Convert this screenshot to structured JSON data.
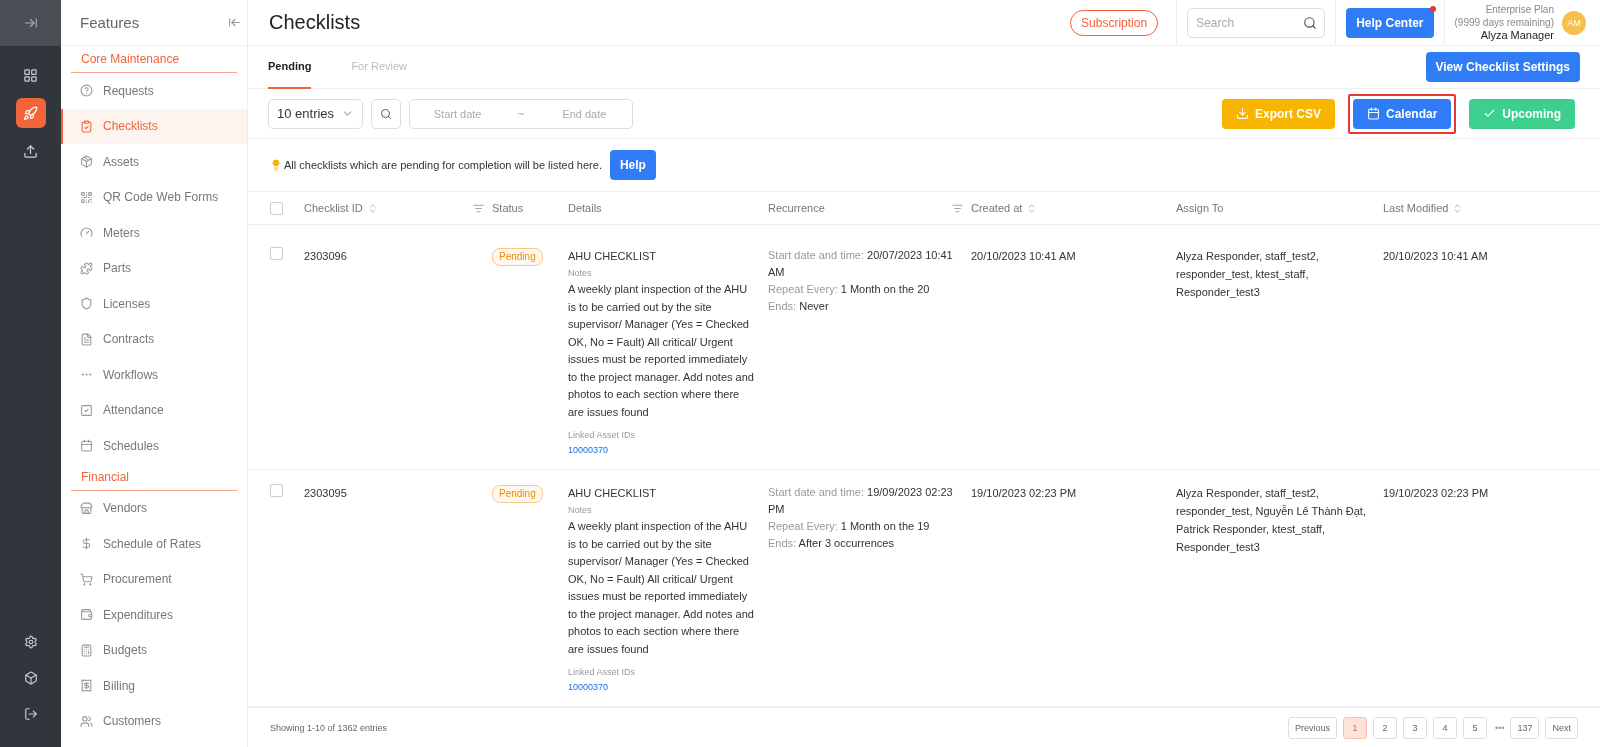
{
  "rail": {
    "items": [
      {
        "selected": false
      },
      {
        "selected": true
      },
      {
        "selected": false
      }
    ],
    "bottom_items": [
      {
        "selected": false
      },
      {
        "selected": false
      },
      {
        "selected": false
      }
    ]
  },
  "sidebar": {
    "title": "Features",
    "sections": [
      {
        "title": "Core Maintenance",
        "items": [
          {
            "label": "Requests",
            "selected": false
          },
          {
            "label": "Checklists",
            "selected": true
          },
          {
            "label": "Assets",
            "selected": false
          },
          {
            "label": "QR Code Web Forms",
            "selected": false
          },
          {
            "label": "Meters",
            "selected": false
          },
          {
            "label": "Parts",
            "selected": false
          },
          {
            "label": "Licenses",
            "selected": false
          },
          {
            "label": "Contracts",
            "selected": false
          },
          {
            "label": "Workflows",
            "selected": false
          },
          {
            "label": "Attendance",
            "selected": false
          },
          {
            "label": "Schedules",
            "selected": false
          }
        ]
      },
      {
        "title": "Financial",
        "items": [
          {
            "label": "Vendors",
            "selected": false
          },
          {
            "label": "Schedule of Rates",
            "selected": false
          },
          {
            "label": "Procurement",
            "selected": false
          },
          {
            "label": "Expenditures",
            "selected": false
          },
          {
            "label": "Budgets",
            "selected": false
          },
          {
            "label": "Billing",
            "selected": false
          },
          {
            "label": "Customers",
            "selected": false
          }
        ]
      }
    ]
  },
  "header": {
    "title": "Checklists",
    "subscription": "Subscription",
    "search": {
      "placeholder": "Search"
    },
    "help_center": {
      "label": "Help Center",
      "has_notification": true
    },
    "plan": "Enterprise Plan",
    "plan_remaining": "(9999 days remaining)",
    "user": "Alyza Manager",
    "avatar": "AM"
  },
  "tabs": [
    {
      "label": "Pending",
      "selected": true
    },
    {
      "label": "For Review",
      "selected": false
    }
  ],
  "settings_button": "View Checklist Settings",
  "toolbar": {
    "entries": "10 entries",
    "start_placeholder": "Start date",
    "separator": "~",
    "end_placeholder": "End date",
    "buttons": [
      {
        "kind": "export",
        "label": "Export CSV",
        "highlighted": false
      },
      {
        "kind": "calendar",
        "label": "Calendar",
        "highlighted": true
      },
      {
        "kind": "upcoming",
        "label": "Upcoming",
        "highlighted": false
      }
    ]
  },
  "info": {
    "text": "All checklists which are pending for completion will be listed here.",
    "button": "Help"
  },
  "table": {
    "select_all_checked": false,
    "columns": [
      {
        "label": "Checklist ID",
        "sortable": true,
        "filterable": true
      },
      {
        "label": "Status",
        "sortable": false,
        "filterable": false
      },
      {
        "label": "Details",
        "sortable": false,
        "filterable": false
      },
      {
        "label": "Recurrence",
        "sortable": false,
        "filterable": true
      },
      {
        "label": "Created at",
        "sortable": true,
        "filterable": false
      },
      {
        "label": "Assign To",
        "sortable": false,
        "filterable": false
      },
      {
        "label": "Last Modified",
        "sortable": true,
        "filterable": false
      }
    ],
    "rows": [
      {
        "checked": false,
        "id": "2303096",
        "status": "Pending",
        "title": "AHU CHECKLIST",
        "notes_label": "Notes",
        "notes": "A weekly plant inspection of the AHU is to be carried out by the site supervisor/ Manager (Yes = Checked OK, No = Fault) All critical/ Urgent issues must be reported immediately to the project manager. Add notes and photos to each section where there are issues found",
        "linked_label": "Linked Asset IDs",
        "linked_id": "10000370",
        "recurrence": [
          {
            "label": "Start date and time:",
            "value": "20/07/2023 10:41 AM"
          },
          {
            "label": "Repeat Every:",
            "value": "1 Month on the 20"
          },
          {
            "label": "Ends:",
            "value": "Never"
          }
        ],
        "created": "20/10/2023 10:41 AM",
        "assign": "Alyza Responder, staff_test2, responder_test, ktest_staff, Responder_test3",
        "modified": "20/10/2023 10:41 AM"
      },
      {
        "checked": false,
        "id": "2303095",
        "status": "Pending",
        "title": "AHU CHECKLIST",
        "notes_label": "Notes",
        "notes": "A weekly plant inspection of the AHU is to be carried out by the site supervisor/ Manager (Yes = Checked OK, No = Fault) All critical/ Urgent issues must be reported immediately to the project manager. Add notes and photos to each section where there are issues found",
        "linked_label": "Linked Asset IDs",
        "linked_id": "10000370",
        "recurrence": [
          {
            "label": "Start date and time:",
            "value": "19/09/2023 02:23 PM"
          },
          {
            "label": "Repeat Every:",
            "value": "1 Month on the 19"
          },
          {
            "label": "Ends:",
            "value": "After 3 occurrences"
          }
        ],
        "created": "19/10/2023 02:23 PM",
        "assign": "Alyza Responder, staff_test2, responder_test, Nguyễn Lê Thành Đạt, Patrick Responder, ktest_staff, Responder_test3",
        "modified": "19/10/2023 02:23 PM"
      }
    ]
  },
  "footer": {
    "summary": "Showing 1-10 of 1362 entries",
    "previous": "Previous",
    "pages": [
      {
        "label": "1",
        "selected": true
      },
      {
        "label": "2",
        "selected": false
      },
      {
        "label": "3",
        "selected": false
      },
      {
        "label": "4",
        "selected": false
      },
      {
        "label": "5",
        "selected": false
      }
    ],
    "ellipsis": "•••",
    "last_page": {
      "label": "137",
      "selected": false
    },
    "next": "Next"
  }
}
